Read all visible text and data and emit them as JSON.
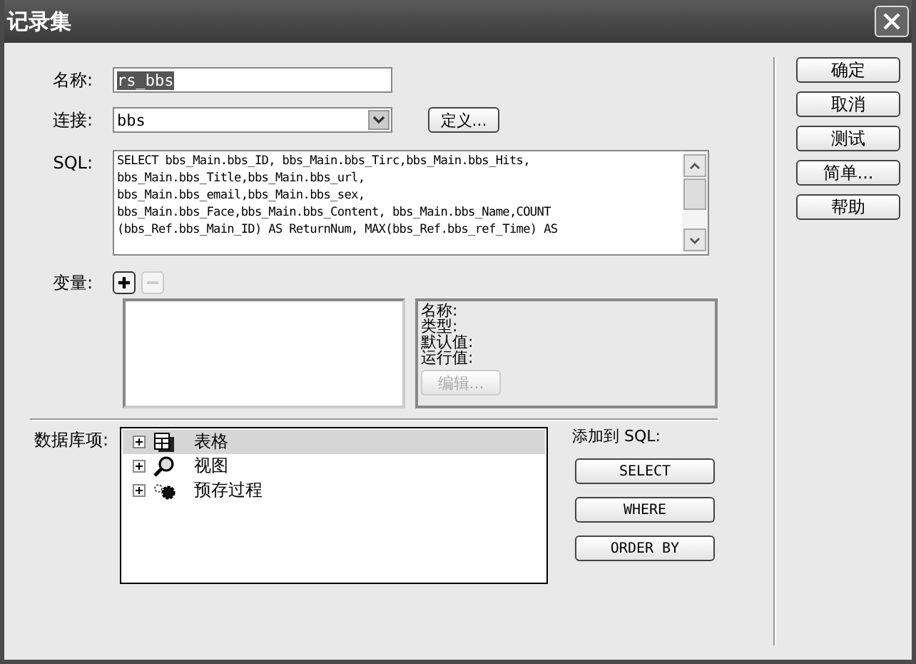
{
  "window": {
    "title": "记录集"
  },
  "name_field": {
    "label": "名称:",
    "value": "rs_bbs",
    "selected": true
  },
  "connection": {
    "label": "连接:",
    "value": "bbs",
    "define_button": "定义..."
  },
  "sql": {
    "label": "SQL:",
    "lines": [
      "SELECT bbs_Main.bbs_ID, bbs_Main.bbs_Tirc,bbs_Main.bbs_Hits,",
      "bbs_Main.bbs_Title,bbs_Main.bbs_url,",
      "bbs_Main.bbs_email,bbs_Main.bbs_sex,",
      "bbs_Main.bbs_Face,bbs_Main.bbs_Content, bbs_Main.bbs_Name,COUNT",
      "(bbs_Ref.bbs_Main_ID) AS ReturnNum, MAX(bbs_Ref.bbs_ref_Time) AS"
    ]
  },
  "variables": {
    "label": "变量:",
    "add_disabled": false,
    "remove_disabled": true,
    "details": [
      "名称:",
      "类型:",
      "默认值:",
      "运行值:"
    ],
    "edit_button": {
      "label": "编辑...",
      "disabled": true
    }
  },
  "database_items": {
    "label": "数据库项:",
    "items": [
      {
        "kind": "table",
        "label": "表格",
        "selected": true,
        "expanded": false
      },
      {
        "kind": "view",
        "label": "视图",
        "selected": false,
        "expanded": false
      },
      {
        "kind": "procedure",
        "label": "预存过程",
        "selected": false,
        "expanded": false
      }
    ]
  },
  "add_to_sql": {
    "label": "添加到 SQL:",
    "buttons": [
      "SELECT",
      "WHERE",
      "ORDER BY"
    ]
  },
  "side_buttons": [
    "确定",
    "取消",
    "测试",
    "简单...",
    "帮助"
  ]
}
